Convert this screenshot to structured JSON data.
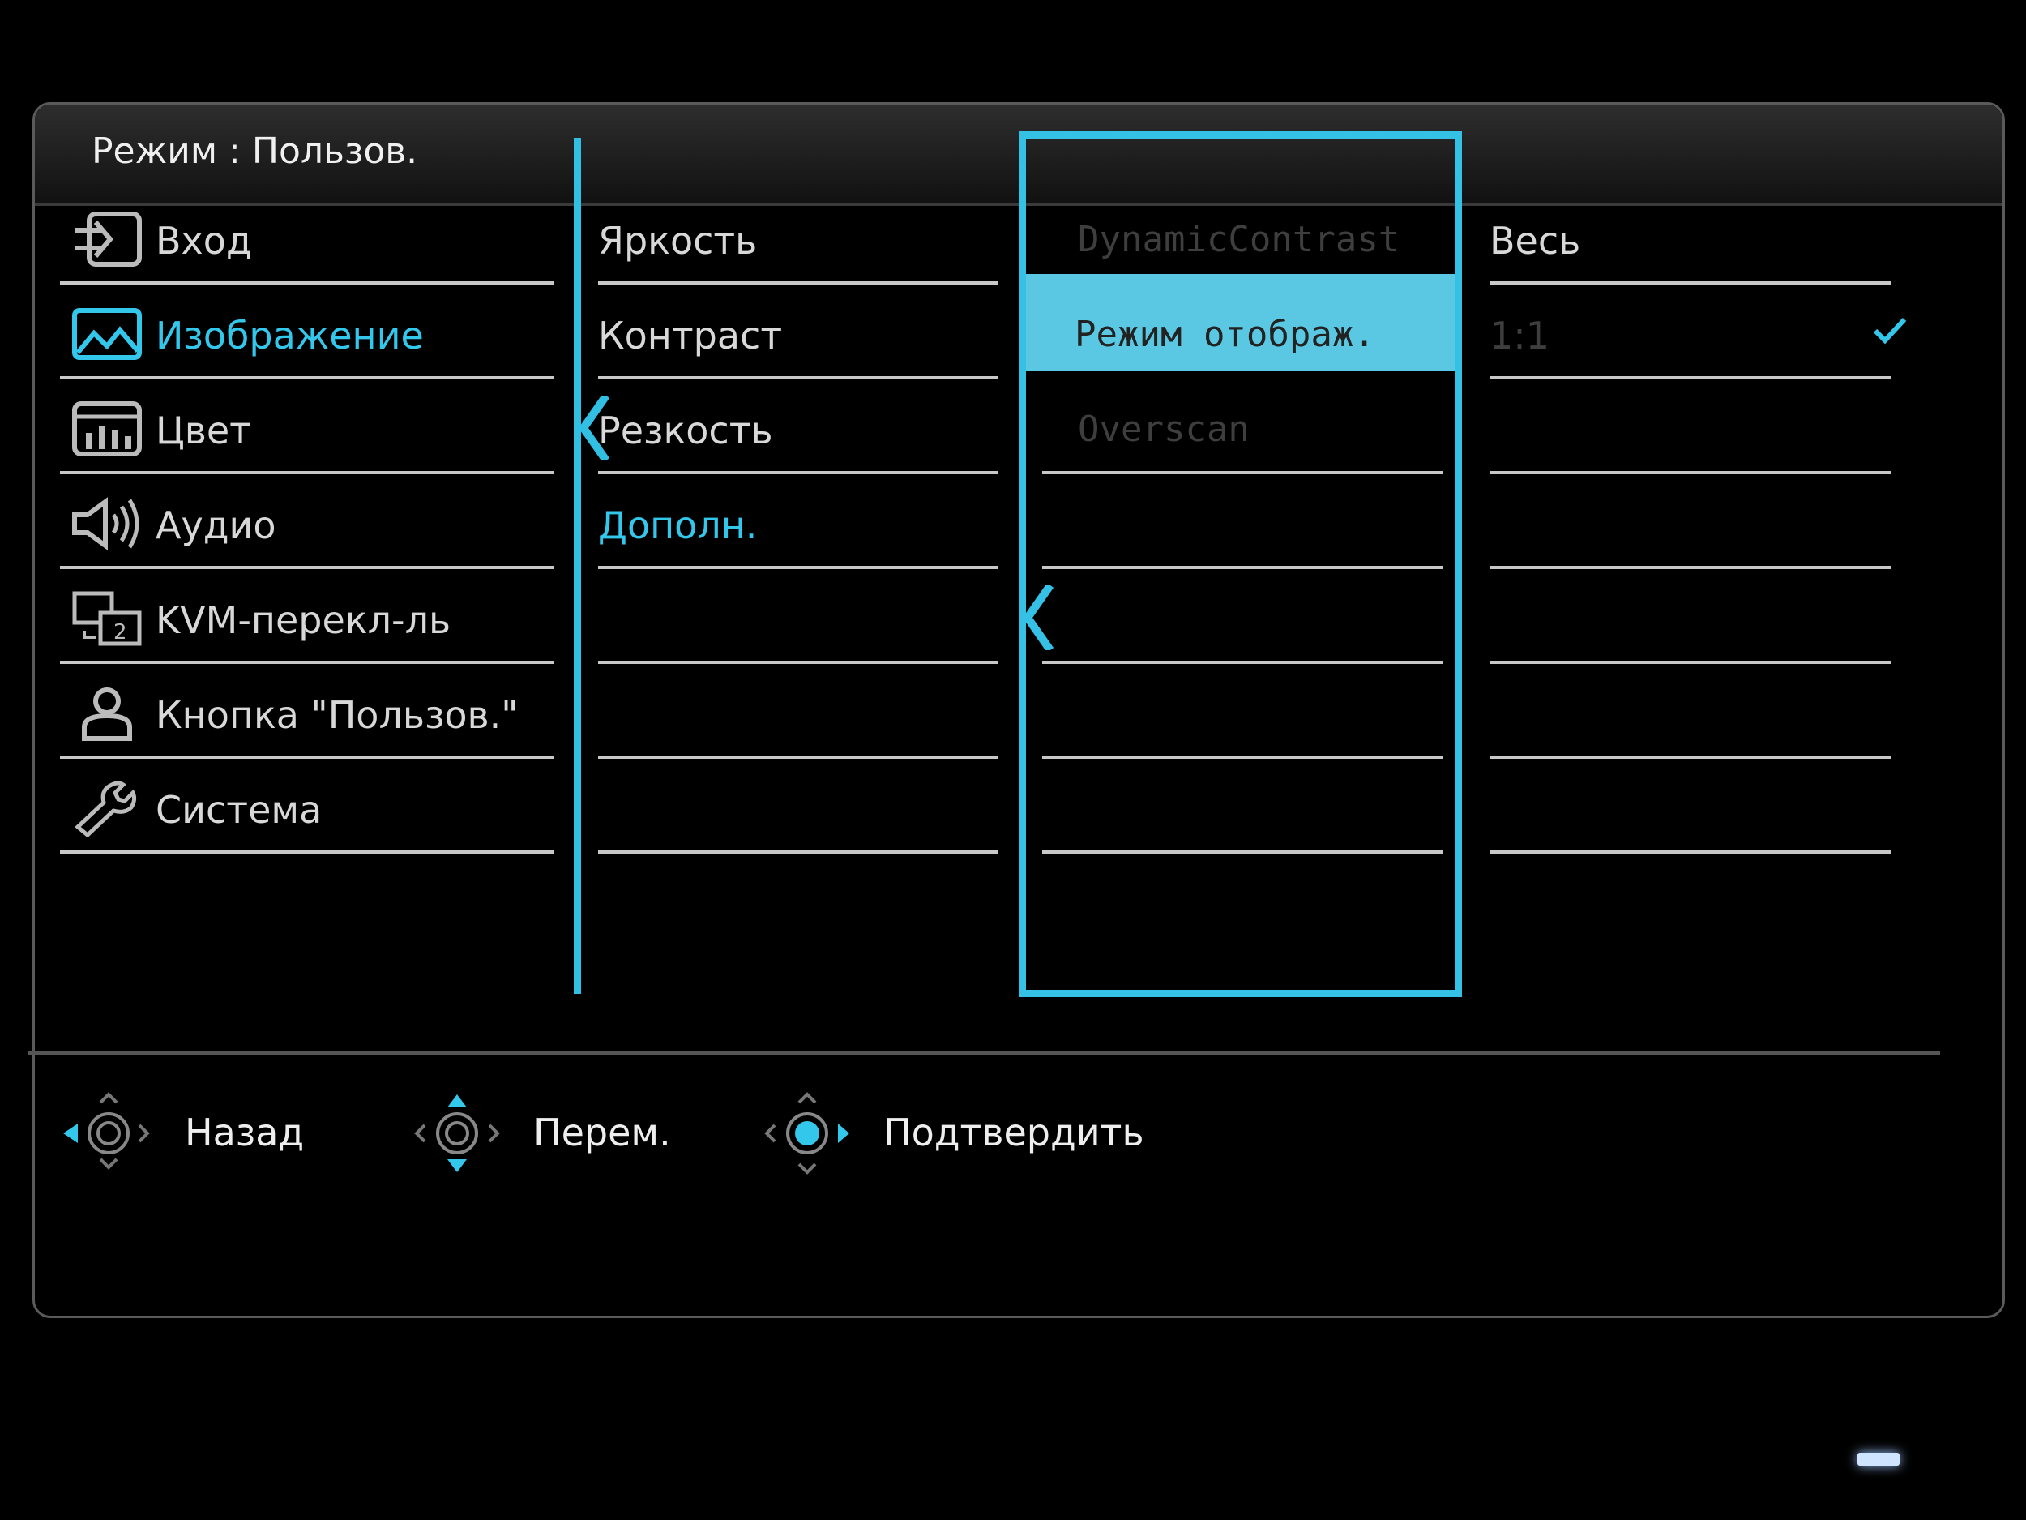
{
  "header": {
    "title_left": "Режим",
    "title_sep": ":",
    "title_right": "Пользов."
  },
  "main_menu": [
    {
      "label": "Вход",
      "icon": "input-icon",
      "active": false
    },
    {
      "label": "Изображение",
      "icon": "picture-icon",
      "active": true
    },
    {
      "label": "Цвет",
      "icon": "color-icon",
      "active": false
    },
    {
      "label": "Аудио",
      "icon": "speaker-icon",
      "active": false
    },
    {
      "label": "KVM-перекл-ль",
      "icon": "kvm-icon",
      "active": false
    },
    {
      "label": "Кнопка \"Пользов.\"",
      "icon": "user-icon",
      "active": false
    },
    {
      "label": "Система",
      "icon": "wrench-icon",
      "active": false
    }
  ],
  "sub_menu": [
    {
      "label": "Яркость"
    },
    {
      "label": "Контраст"
    },
    {
      "label": "Резкость"
    },
    {
      "label": "Дополн.",
      "active": true
    },
    {
      "label": ""
    },
    {
      "label": ""
    },
    {
      "label": ""
    }
  ],
  "advanced_menu": [
    {
      "label": "DynamicContrast",
      "disabled": true
    },
    {
      "label": "Режим отображ.",
      "selected": true
    },
    {
      "label": "Overscan",
      "disabled": true
    },
    {
      "label": ""
    },
    {
      "label": ""
    },
    {
      "label": ""
    },
    {
      "label": ""
    }
  ],
  "options": [
    {
      "label": "Весь",
      "checked": true
    },
    {
      "label": "1:1",
      "disabled": true
    },
    {
      "label": ""
    },
    {
      "label": ""
    },
    {
      "label": ""
    },
    {
      "label": ""
    },
    {
      "label": ""
    }
  ],
  "footer": {
    "back": "Назад",
    "move": "Перем.",
    "confirm": "Подтвердить"
  },
  "colors": {
    "accent": "#33c7ec",
    "highlight": "#5ac8e2",
    "text": "#d8d8d8",
    "disabled": "#3e3e3e"
  }
}
